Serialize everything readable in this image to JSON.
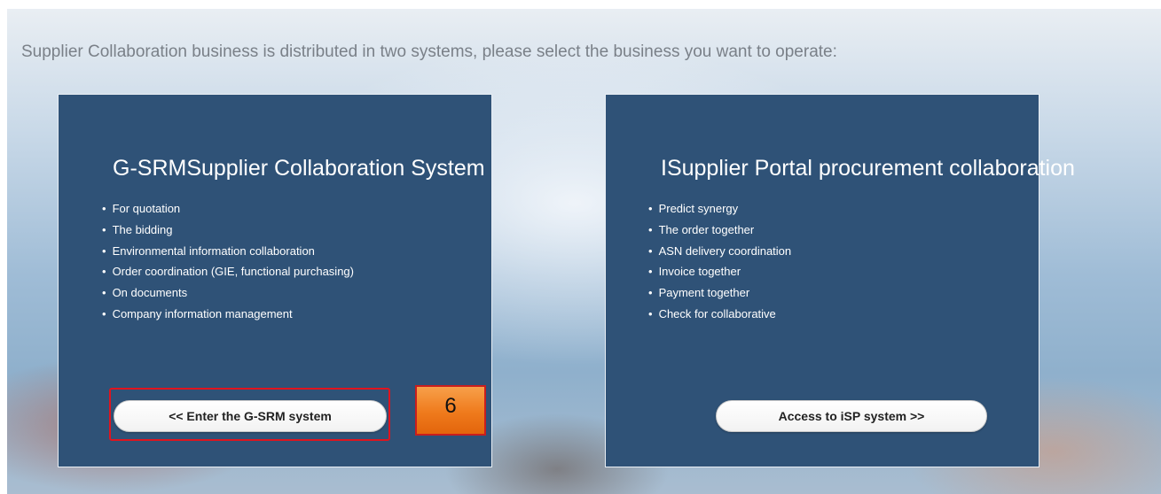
{
  "prompt": "Supplier Collaboration business is distributed in two systems, please select the business you want to operate:",
  "gsrm": {
    "title": "G-SRMSupplier Collaboration System",
    "features": [
      "For quotation",
      "The bidding",
      "Environmental information collaboration",
      "Order coordination (GIE, functional purchasing)",
      "On documents",
      "Company information management"
    ],
    "button_label": "<< Enter the G-SRM system"
  },
  "isp": {
    "title": "ISupplier Portal procurement collaboration",
    "features": [
      "Predict synergy",
      "The order together",
      "ASN delivery coordination",
      "Invoice together",
      "Payment together",
      "Check for collaborative"
    ],
    "button_label": "Access to iSP system >>"
  },
  "annotation": {
    "step_number": "6",
    "highlight_color": "#e0141e",
    "badge_color": "#ef7a1c"
  },
  "colors": {
    "panel_bg": "#2f5277",
    "prompt_text": "#7a8088"
  }
}
